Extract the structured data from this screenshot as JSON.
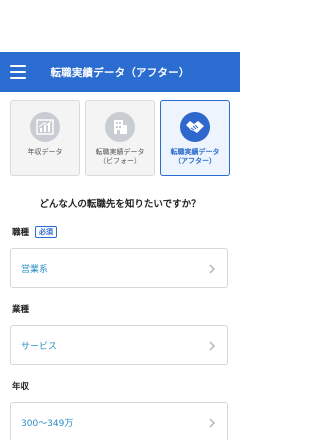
{
  "header": {
    "title": "転職実績データ（アフター）",
    "background": "#2a6ccf",
    "menu_icon": "hamburger-menu-icon"
  },
  "cards": [
    {
      "label_lines": [
        "年収データ"
      ],
      "icon": "bar-chart-icon",
      "active": false
    },
    {
      "label_lines": [
        "転職実績データ",
        "（ビフォー）"
      ],
      "icon": "office-building-icon",
      "active": false
    },
    {
      "label_lines": [
        "転職実績データ",
        "（アフター）"
      ],
      "icon": "handshake-icon",
      "active": true
    }
  ],
  "question": "どんな人の転職先を知りたいですか？",
  "fields": [
    {
      "label": "職種",
      "badge": "必須",
      "value": "営業系"
    },
    {
      "label": "業種",
      "badge": "",
      "value": "サービス"
    },
    {
      "label": "年収",
      "badge": "",
      "value": "300〜349万"
    }
  ],
  "colors": {
    "accent": "#2a6ccf",
    "value_text": "#2a8fc6"
  }
}
